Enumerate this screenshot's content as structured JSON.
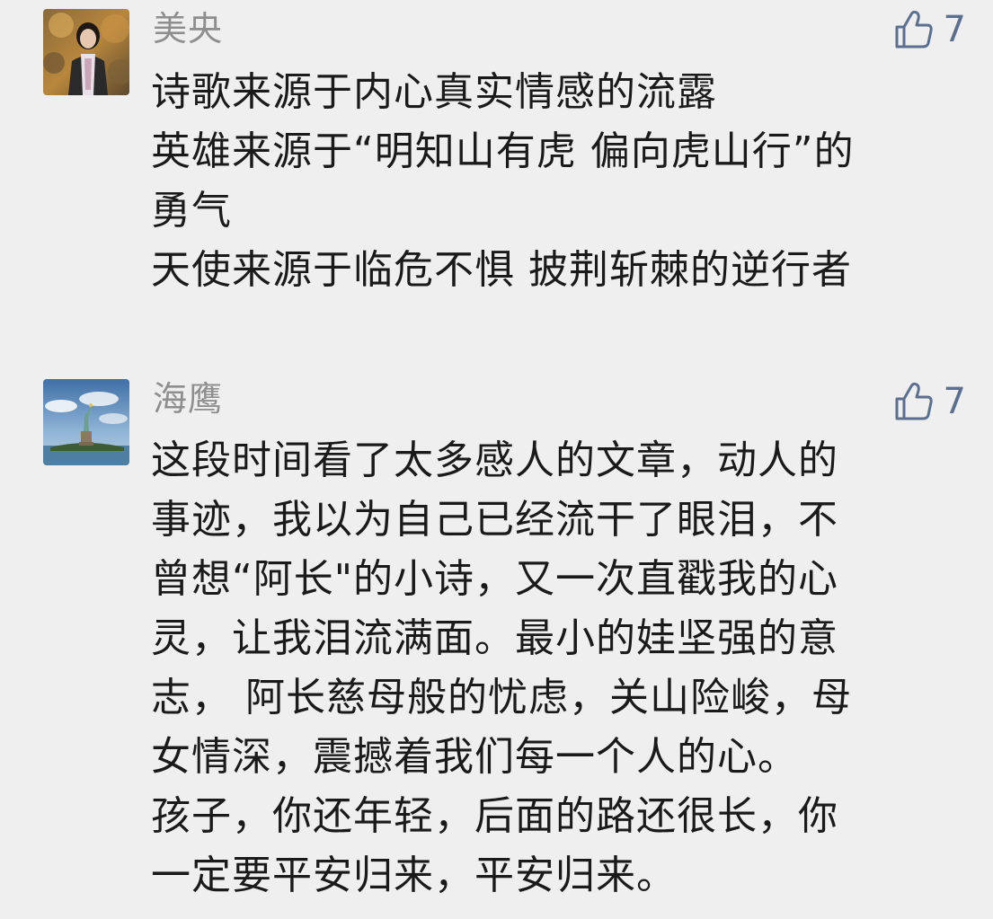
{
  "comments": [
    {
      "username": "美央",
      "likes": "7",
      "avatar_icon": "portrait-avatar",
      "lines": [
        "诗歌来源于内心真实情感的流露",
        "英雄来源于“明知山有虎 偏向虎山行”的",
        "勇气",
        "天使来源于临危不惧 披荆斩棘的逆行者"
      ]
    },
    {
      "username": "海鹰",
      "likes": "7",
      "avatar_icon": "statue-of-liberty-avatar",
      "lines": [
        "这段时间看了太多感人的文章，动人的",
        "事迹，我以为自己已经流干了眼泪，不",
        "曾想“阿长\"的小诗，又一次直戳我的心",
        "灵，让我泪流满面。最小的娃坚强的意",
        "志， 阿长慈母般的忧虑，关山险峻，母",
        "女情深，震撼着我们每一个人的心。",
        "孩子，你还年轻，后面的路还很长，你",
        "一定要平安归来，平安归来。"
      ]
    }
  ],
  "colors": {
    "background": "#efefef",
    "username": "#8e8e8e",
    "like": "#5c6f8f",
    "text": "#1a1a1a"
  },
  "icons": {
    "like": "thumbs-up-icon"
  }
}
